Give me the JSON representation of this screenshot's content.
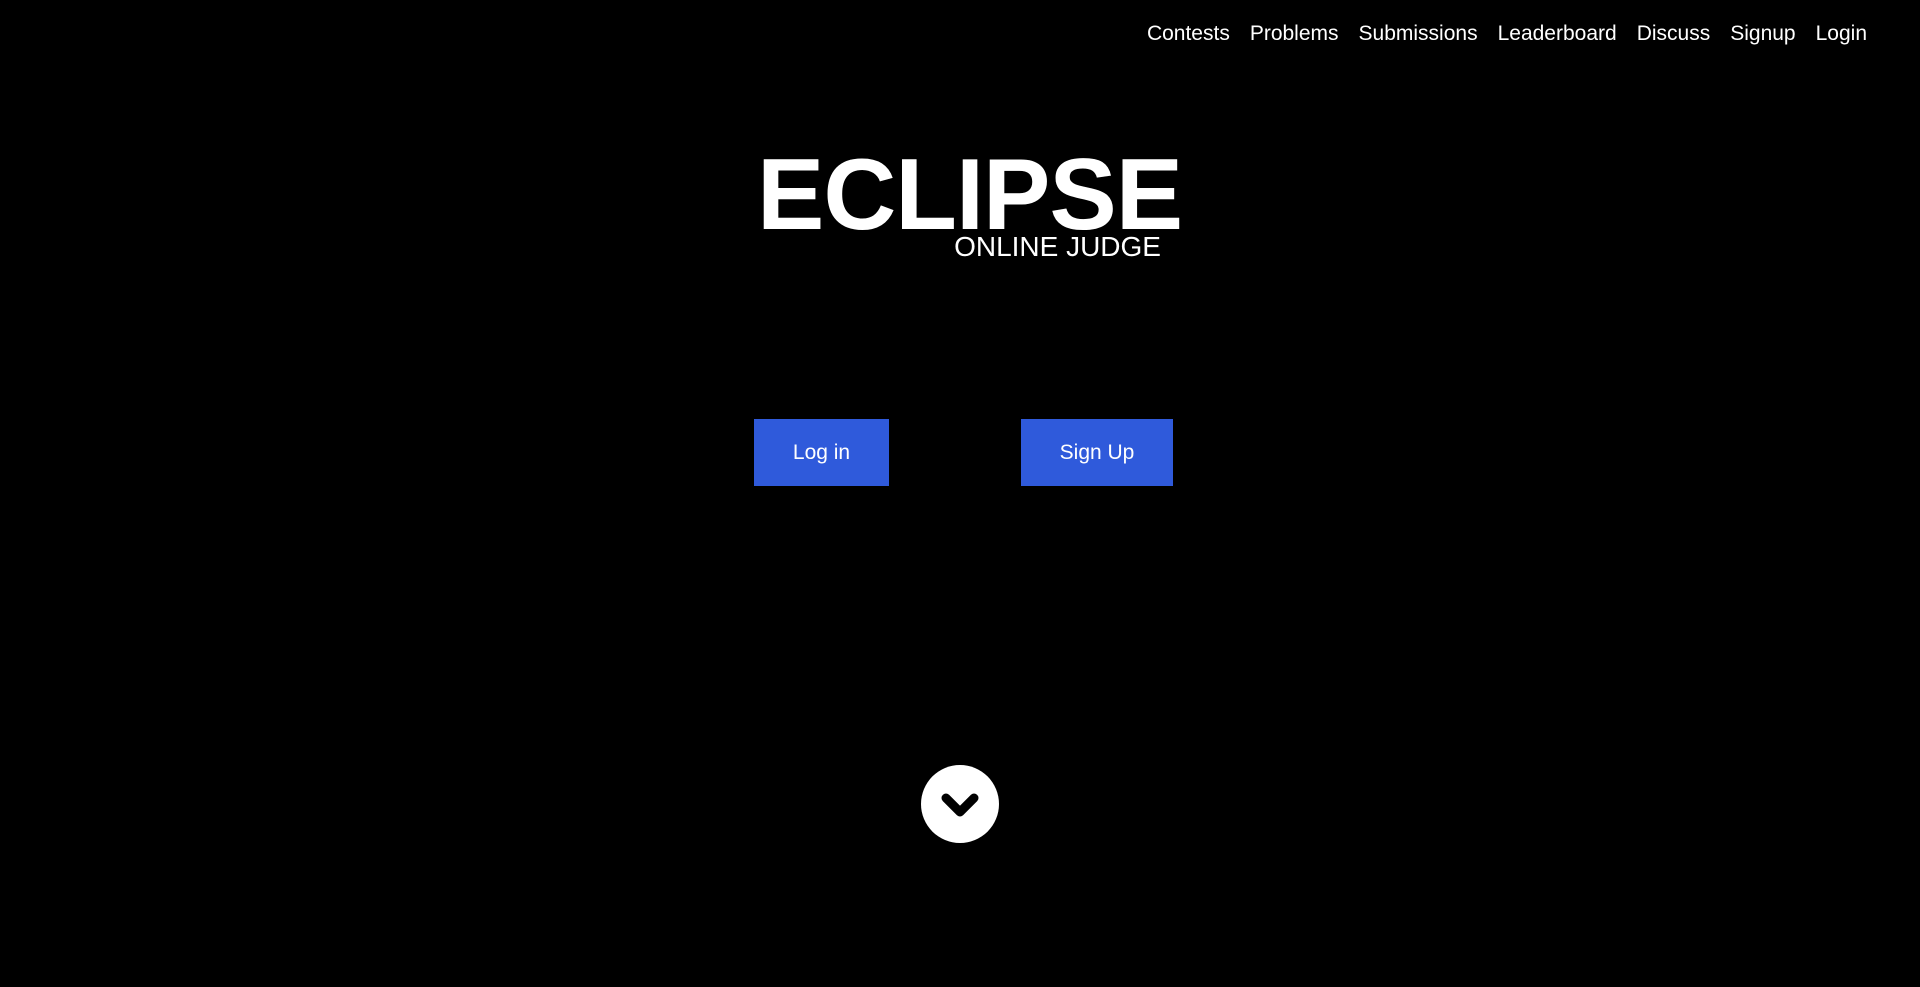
{
  "nav": {
    "items": [
      {
        "label": "Contests"
      },
      {
        "label": "Problems"
      },
      {
        "label": "Submissions"
      },
      {
        "label": "Leaderboard"
      },
      {
        "label": "Discuss"
      },
      {
        "label": "Signup"
      },
      {
        "label": "Login"
      }
    ]
  },
  "hero": {
    "title": "ECLIPSE",
    "subtitle": "ONLINE JUDGE"
  },
  "actions": {
    "login_label": "Log in",
    "signup_label": "Sign Up"
  },
  "scroll": {
    "icon": "chevron-circle-down-icon"
  },
  "colors": {
    "background": "#000000",
    "text": "#ffffff",
    "button": "#2f5adb"
  }
}
